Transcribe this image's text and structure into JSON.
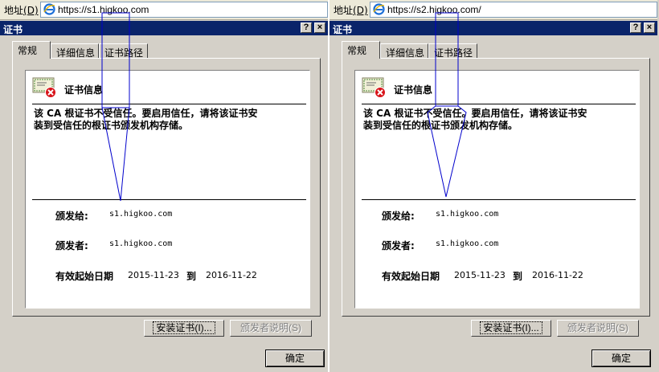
{
  "address_bar": {
    "label": "地址",
    "accelerator": "(D)"
  },
  "dialog": {
    "title": "证书",
    "help_button": "?",
    "close_button": "×",
    "tabs": [
      "常规",
      "详细信息",
      "证书路径"
    ],
    "cert_info_title": "证书信息",
    "warning_line1": "该 CA 根证书不受信任。要启用信任，请将该证书安",
    "warning_line2": "装到受信任的根证书颁发机构存储。",
    "issued_to_label": "颁发给:",
    "issued_by_label": "颁发者:",
    "valid_from_label": "有效起始日期",
    "to_label": "到",
    "valid_from": "2015-11-23",
    "valid_to": "2016-11-22",
    "install_button": "安装证书(I)...",
    "issuer_statement_button": "颁发者说明(S)",
    "ok_button": "确定"
  },
  "panes": [
    {
      "url": "https://s1.higkoo.com",
      "subject": "s1.higkoo.com",
      "issuer": "s1.higkoo.com"
    },
    {
      "url": "https://s2.higkoo.com/",
      "subject": "s1.higkoo.com",
      "issuer": "s1.higkoo.com"
    }
  ],
  "colors": {
    "titlebar": "#0a246a",
    "window_face": "#d4d0c8",
    "annotation": "#0000cc"
  }
}
